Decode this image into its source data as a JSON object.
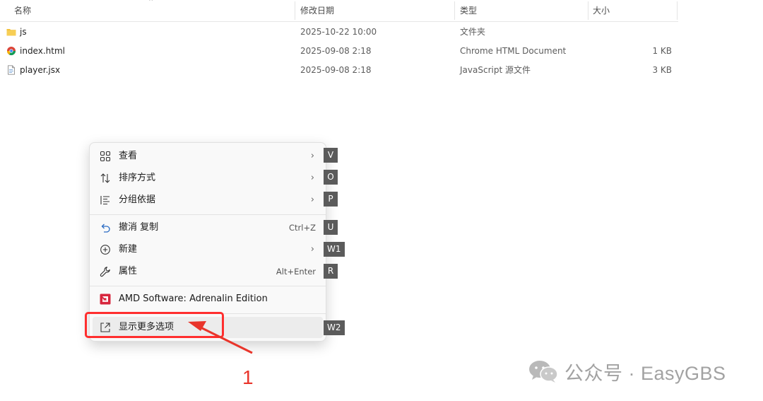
{
  "columns": {
    "name": "名称",
    "modified": "修改日期",
    "type": "类型",
    "size": "大小"
  },
  "files": [
    {
      "name": "js",
      "modified": "2025-10-22 10:00",
      "type": "文件夹",
      "size": "",
      "icon": "folder-icon"
    },
    {
      "name": "index.html",
      "modified": "2025-09-08 2:18",
      "type": "Chrome HTML Document",
      "size": "1 KB",
      "icon": "chrome-file-icon"
    },
    {
      "name": "player.jsx",
      "modified": "2025-09-08 2:18",
      "type": "JavaScript 源文件",
      "size": "3 KB",
      "icon": "file-icon"
    }
  ],
  "context_menu": {
    "items": [
      {
        "label": "查看",
        "submenu": true,
        "access_key": "V",
        "icon": "view-grid-icon"
      },
      {
        "label": "排序方式",
        "submenu": true,
        "access_key": "O",
        "icon": "sort-icon"
      },
      {
        "label": "分组依据",
        "submenu": true,
        "access_key": "P",
        "icon": "group-list-icon"
      },
      {
        "label": "撤消 复制",
        "shortcut": "Ctrl+Z",
        "access_key": "U",
        "icon": "undo-icon"
      },
      {
        "label": "新建",
        "submenu": true,
        "access_key": "W1",
        "icon": "new-plus-icon"
      },
      {
        "label": "属性",
        "shortcut": "Alt+Enter",
        "access_key": "R",
        "icon": "wrench-icon"
      },
      {
        "label": "AMD Software: Adrenalin Edition",
        "access_key": "",
        "icon": "amd-logo-icon"
      },
      {
        "label": "显示更多选项",
        "access_key": "W2",
        "icon": "more-options-icon"
      }
    ]
  },
  "annotation": {
    "step_number": "1",
    "color": "#e9352b"
  },
  "watermark": {
    "text": "公众号 · EasyGBS"
  },
  "colors": {
    "menu_bg": "#f9f9f9",
    "key_badge": "#5b5b5b",
    "folder": "#f3c13a",
    "amd_red": "#d7263d"
  }
}
